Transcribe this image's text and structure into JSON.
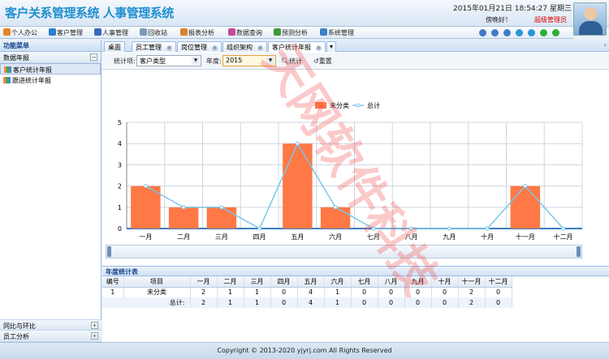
{
  "header": {
    "app_title": "客户关系管理系统 人事管理系统",
    "datetime": "2015年01月21日 18:54:27 星期三",
    "greeting": "傍晚好！",
    "user_role": "超级管理员"
  },
  "menu": {
    "items": [
      {
        "label": "个人办公",
        "icon": "home-icon",
        "color": "#e8832a"
      },
      {
        "label": "客户管理",
        "icon": "customer-icon",
        "color": "#2b7fd0"
      },
      {
        "label": "人事管理",
        "icon": "people-icon",
        "color": "#3a66c0"
      },
      {
        "label": "回收站",
        "icon": "recycle-icon",
        "color": "#7b9bb8"
      },
      {
        "label": "报表分析",
        "icon": "report-icon",
        "color": "#d9822b"
      },
      {
        "label": "数据查询",
        "icon": "query-icon",
        "color": "#c04a9a"
      },
      {
        "label": "预测分析",
        "icon": "forecast-icon",
        "color": "#3b9b3b"
      },
      {
        "label": "系统管理",
        "icon": "settings-icon",
        "color": "#3a82c9"
      }
    ],
    "tool_icons": [
      {
        "name": "home-tool-icon",
        "color": "#3f7cc7"
      },
      {
        "name": "lock-tool-icon",
        "color": "#3f7cc7"
      },
      {
        "name": "user-tool-icon",
        "color": "#3f7cc7"
      },
      {
        "name": "refresh-tool-icon",
        "color": "#2a95d6"
      },
      {
        "name": "help-tool-icon",
        "color": "#2a95d6"
      },
      {
        "name": "chat-tool-icon",
        "color": "#2fae3a"
      },
      {
        "name": "exit-tool-icon",
        "color": "#2fae3a"
      }
    ]
  },
  "sidebar": {
    "title": "功能菜单",
    "group": "数据年报",
    "items": [
      {
        "label": "客户统计年报",
        "active": true
      },
      {
        "label": "跟进统计年报",
        "active": false
      }
    ],
    "bottom_groups": [
      "同比与环比",
      "员工分析"
    ]
  },
  "tabs": [
    {
      "label": "桌面",
      "closable": false
    },
    {
      "label": "员工管理",
      "closable": true
    },
    {
      "label": "岗位管理",
      "closable": true
    },
    {
      "label": "组织架构",
      "closable": true
    },
    {
      "label": "客户统计年报",
      "closable": true,
      "active": true
    }
  ],
  "toolbar": {
    "stat_item_label": "统计项:",
    "stat_item_value": "客户类型",
    "year_label": "年度:",
    "year_value": "2015",
    "stat_button": "统计",
    "reset_button": "重置"
  },
  "chart_data": {
    "type": "bar",
    "categories": [
      "一月",
      "二月",
      "三月",
      "四月",
      "五月",
      "六月",
      "七月",
      "八月",
      "九月",
      "十月",
      "十一月",
      "十二月"
    ],
    "series": [
      {
        "name": "未分类",
        "kind": "bar",
        "color": "#ff7845",
        "values": [
          2,
          1,
          1,
          0,
          4,
          1,
          0,
          0,
          0,
          0,
          2,
          0
        ]
      },
      {
        "name": "总计",
        "kind": "line",
        "color": "#7cc6e8",
        "values": [
          2,
          1,
          1,
          0,
          4,
          1,
          0,
          0,
          0,
          0,
          2,
          0
        ]
      }
    ],
    "ylim": [
      0,
      5
    ],
    "yticks": [
      0,
      1,
      2,
      3,
      4,
      5
    ],
    "grid": true,
    "legend": "top-center"
  },
  "stats": {
    "title": "年度统计表",
    "headers": [
      "编号",
      "项目",
      "一月",
      "二月",
      "三月",
      "四月",
      "五月",
      "六月",
      "七月",
      "八月",
      "九月",
      "十月",
      "十一月",
      "十二月"
    ],
    "rows": [
      [
        "1",
        "未分类",
        "2",
        "1",
        "1",
        "0",
        "4",
        "1",
        "0",
        "0",
        "0",
        "0",
        "2",
        "0"
      ]
    ],
    "total": {
      "label": "总计:",
      "values": [
        "2",
        "1",
        "1",
        "0",
        "4",
        "1",
        "0",
        "0",
        "0",
        "0",
        "2",
        "0"
      ]
    }
  },
  "footer": "Copyright © 2013-2020 yjyrj.com All Rights Reserved",
  "watermark": "天网软件科技"
}
